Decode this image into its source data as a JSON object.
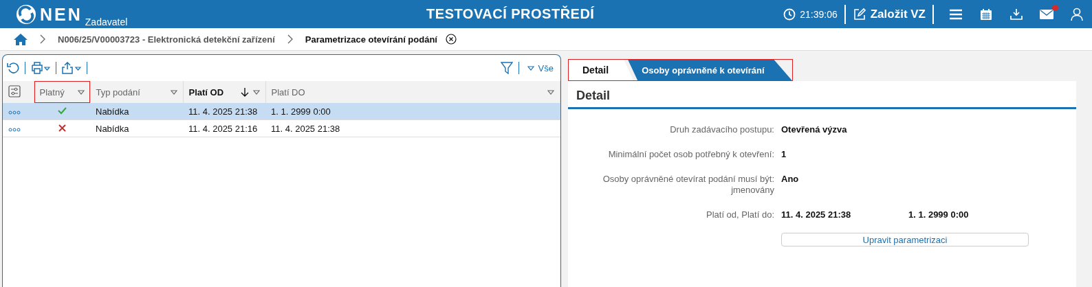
{
  "header": {
    "brand": "NEN",
    "subtitle": "Zadavatel",
    "title": "TESTOVACÍ PROSTŘEDÍ",
    "time": "21:39:06",
    "create_button": "Založit VZ",
    "mail_unread": true
  },
  "breadcrumb": [
    {
      "label": "N006/25/V00003723 - Elektronická detekční zařízení",
      "current": false
    },
    {
      "label": "Parametrizace otevírání podání",
      "current": true
    }
  ],
  "toolbar": {
    "filter_label": "Vše"
  },
  "table": {
    "columns": [
      {
        "label": "Platný",
        "sorted": false,
        "highlighted": true
      },
      {
        "label": "Typ podání",
        "sorted": false,
        "highlighted": false
      },
      {
        "label": "Platí OD",
        "sorted": true,
        "highlighted": false
      },
      {
        "label": "Platí DO",
        "sorted": false,
        "highlighted": false
      }
    ],
    "rows": [
      {
        "selected": true,
        "valid": true,
        "cells": [
          "",
          "Nabídka",
          "11. 4. 2025 21:38",
          "1. 1. 2999 0:00"
        ]
      },
      {
        "selected": false,
        "valid": false,
        "cells": [
          "",
          "Nabídka",
          "11. 4. 2025 21:16",
          "11. 4. 2025 21:38"
        ]
      }
    ]
  },
  "tabs": {
    "highlighted": true,
    "items": [
      {
        "label": "Detail",
        "selected": true
      },
      {
        "label": "Osoby oprávněné k otevírání",
        "selected": false
      }
    ]
  },
  "detail": {
    "title": "Detail",
    "fields": [
      {
        "label": "Druh zadávacího postupu:",
        "values": [
          "Otevřená výzva"
        ]
      },
      {
        "label": "Minimální počet osob potřebný k otevření:",
        "values": [
          "1"
        ]
      },
      {
        "label": "Osoby oprávněné otevírat podání musí být: jmenovány",
        "values": [
          "Ano"
        ]
      },
      {
        "label": "Platí od, Platí do:",
        "values": [
          "11. 4. 2025 21:38",
          "1. 1. 2999 0:00"
        ]
      }
    ],
    "button": "Upravit parametrizaci"
  }
}
